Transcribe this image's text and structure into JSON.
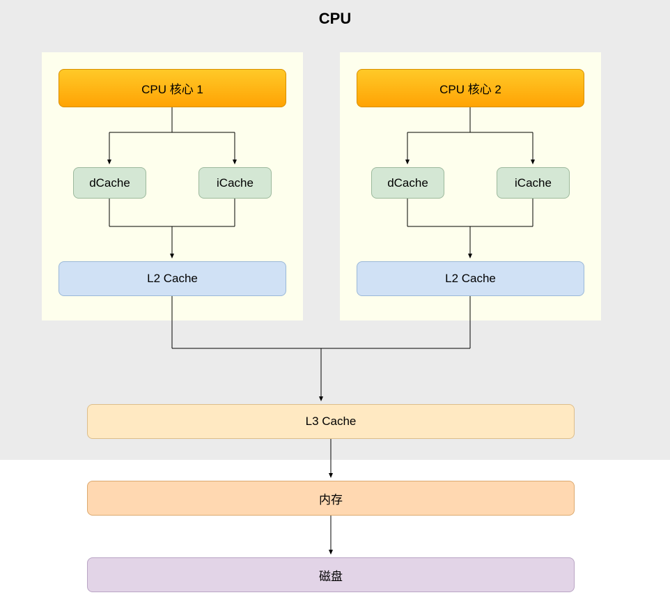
{
  "title": "CPU",
  "cores": [
    {
      "label": "CPU 核心 1",
      "dcache": "dCache",
      "icache": "iCache",
      "l2": "L2 Cache"
    },
    {
      "label": "CPU 核心 2",
      "dcache": "dCache",
      "icache": "iCache",
      "l2": "L2 Cache"
    }
  ],
  "l3": "L3 Cache",
  "memory": "内存",
  "disk": "磁盘",
  "colors": {
    "cpu_bg": "#ebebeb",
    "core_bg": "#feffed",
    "core_node_start": "#ffc928",
    "core_node_end": "#ffa304",
    "cache_small_bg": "#d4e7d4",
    "l2_bg": "#d0e1f5",
    "l3_bg": "#ffe9c2",
    "memory_bg": "#ffd8b1",
    "disk_bg": "#e2d4e7"
  }
}
